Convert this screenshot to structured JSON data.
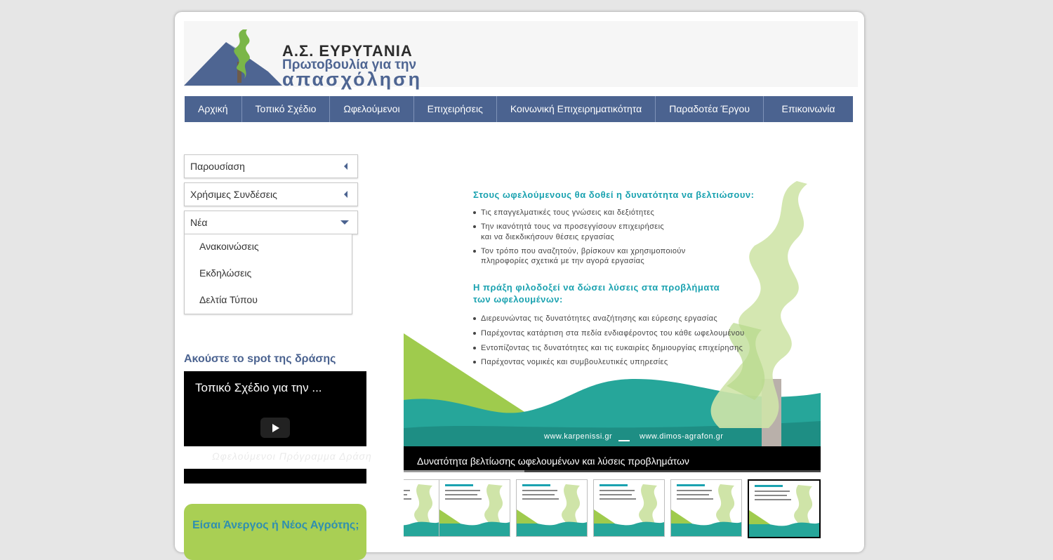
{
  "header": {
    "logo_title": "Α.Σ.  ΕΥΡΥΤΑΝΙΑ",
    "logo_subtitle": "Πρωτοβουλία για την",
    "logo_tagline": "απασχόληση"
  },
  "nav": {
    "items": [
      {
        "label": "Αρχική"
      },
      {
        "label": "Τοπικό Σχέδιο"
      },
      {
        "label": "Ωφελούμενοι"
      },
      {
        "label": "Επιχειρήσεις"
      },
      {
        "label": "Κοινωνική Επιχειρηματικότητα"
      },
      {
        "label": "Παραδοτέα Έργου"
      },
      {
        "label": "Επικοινωνία"
      }
    ]
  },
  "sidebar": {
    "accordion": [
      {
        "label": "Παρουσίαση",
        "expanded": false
      },
      {
        "label": "Χρήσιμες Συνδέσεις",
        "expanded": false
      },
      {
        "label": "Νέα",
        "expanded": true
      }
    ],
    "news_items": [
      {
        "label": "Ανακοινώσεις"
      },
      {
        "label": "Εκδηλώσεις"
      },
      {
        "label": "Δελτία Τύπου"
      }
    ],
    "spot_title": "Ακούστε το spot της δράσης",
    "video_title": "Τοπικό Σχέδιο για την ...",
    "video_faded_text": "Ωφελούμενοι Πρόγραμμα Δράση",
    "green_box_text": "Είσαι Άνεργος ή Νέος Αγρότης;"
  },
  "slider": {
    "heading1": "Στους ωφελούμενους θα δοθεί η δυνατότητα να βελτιώσουν:",
    "bullets1": [
      [
        "Τις επαγγελματικές τους γνώσεις και δεξιότητες"
      ],
      [
        "Την ικανότητά τους να προσεγγίσουν επιχειρήσεις",
        "και να διεκδικήσουν θέσεις εργασίας"
      ],
      [
        "Τον τρόπο που αναζητούν, βρίσκουν και χρησιμοποιούν",
        "πληροφορίες σχετικά με την αγορά εργασίας"
      ]
    ],
    "heading2_line1": "Η πράξη φιλοδοξεί να δώσει λύσεις στα προβλήματα",
    "heading2_line2": "των ωφελουμένων:",
    "bullets2": [
      "Διερευνώντας τις δυνατότητες αναζήτησης και εύρεσης εργασίας",
      "Παρέχοντας κατάρτιση στα πεδία ενδιαφέροντος του κάθε ωφελουμένου",
      "Εντοπίζοντας τις δυνατότητες και τις ευκαιρίες δημιουργίας επιχείρησης",
      "Παρέχοντας νομικές και συμβουλευτικές υπηρεσίες"
    ],
    "url1": "www.karpenissi.gr",
    "url2": "www.dimos-agrafon.gr",
    "caption": "Δυνατότητα βελτίωσης ωφελουμένων και λύσεις προβλημάτων",
    "progress": 0.29,
    "thumbnail_count": 6,
    "active_thumbnail": 6
  },
  "colors": {
    "nav_bg": "#4b6390",
    "teal": "#1aa2b0",
    "green": "#a9cf54",
    "page_bg": "#e6e6e6"
  }
}
